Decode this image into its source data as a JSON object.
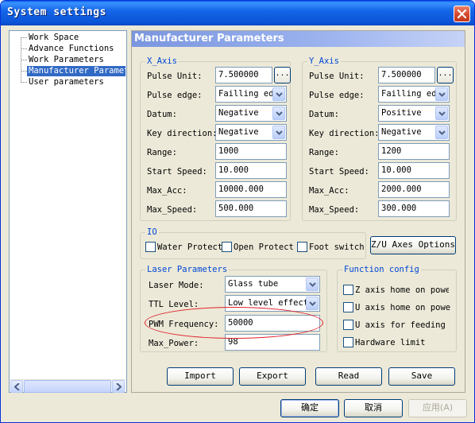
{
  "window": {
    "title": "System settings"
  },
  "tree": {
    "items": [
      {
        "label": "Work Space",
        "selected": false
      },
      {
        "label": "Advance Functions",
        "selected": false
      },
      {
        "label": "Work Parameters",
        "selected": false
      },
      {
        "label": "Manufacturer Paramet",
        "selected": true
      },
      {
        "label": "User parameters",
        "selected": false
      }
    ]
  },
  "panel": {
    "header": "Manufacturer Parameters",
    "x_axis": {
      "title": "X_Axis",
      "pulse_unit_label": "Pulse Unit:",
      "pulse_unit": "7.500000",
      "browse": "...",
      "pulse_edge_label": "Pulse edge:",
      "pulse_edge": "Failling ed",
      "datum_label": "Datum:",
      "datum": "Negative",
      "key_direction_label": "Key direction:",
      "key_direction": "Negative",
      "range_label": "Range:",
      "range": "1000",
      "start_speed_label": "Start Speed:",
      "start_speed": "10.000",
      "max_acc_label": "Max_Acc:",
      "max_acc": "10000.000",
      "max_speed_label": "Max_Speed:",
      "max_speed": "500.000"
    },
    "y_axis": {
      "title": "Y_Axis",
      "pulse_unit_label": "Pulse Unit:",
      "pulse_unit": "7.500000",
      "browse": "...",
      "pulse_edge_label": "Pulse edge:",
      "pulse_edge": "Failling ed",
      "datum_label": "Datum:",
      "datum": "Positive",
      "key_direction_label": "Key direction:",
      "key_direction": "Negative",
      "range_label": "Range:",
      "range": "1200",
      "start_speed_label": "Start Speed:",
      "start_speed": "10.000",
      "max_acc_label": "Max_Acc:",
      "max_acc": "2000.000",
      "max_speed_label": "Max_Speed:",
      "max_speed": "300.000"
    },
    "io": {
      "title": "IO",
      "water_protect": "Water Protect",
      "open_protect": "Open Protect",
      "foot_switch": "Foot switch"
    },
    "zu_axes_button": "Z/U Axes Options",
    "laser": {
      "title": "Laser Parameters",
      "mode_label": "Laser Mode:",
      "mode": "Glass tube",
      "ttl_label": "TTL Level:",
      "ttl": "Low level effect",
      "pwm_label": "PWM Frequency:",
      "pwm": "50000",
      "max_power_label": "Max_Power:",
      "max_power": "98"
    },
    "function_config": {
      "title": "Function config",
      "z_home": "Z axis home on power",
      "u_home": "U axis home on power",
      "u_feeding": "U axis for feeding",
      "hw_limit": "Hardware limit"
    },
    "buttons": {
      "import": "Import",
      "export": "Export",
      "read": "Read",
      "save": "Save"
    }
  },
  "footer": {
    "ok": "确定",
    "cancel": "取消",
    "apply": "应用(A)"
  },
  "colors": {
    "title_bar": "#0b54d8",
    "group_title": "#0046d5",
    "selection": "#316ac5",
    "annotation": "#e0202a"
  }
}
